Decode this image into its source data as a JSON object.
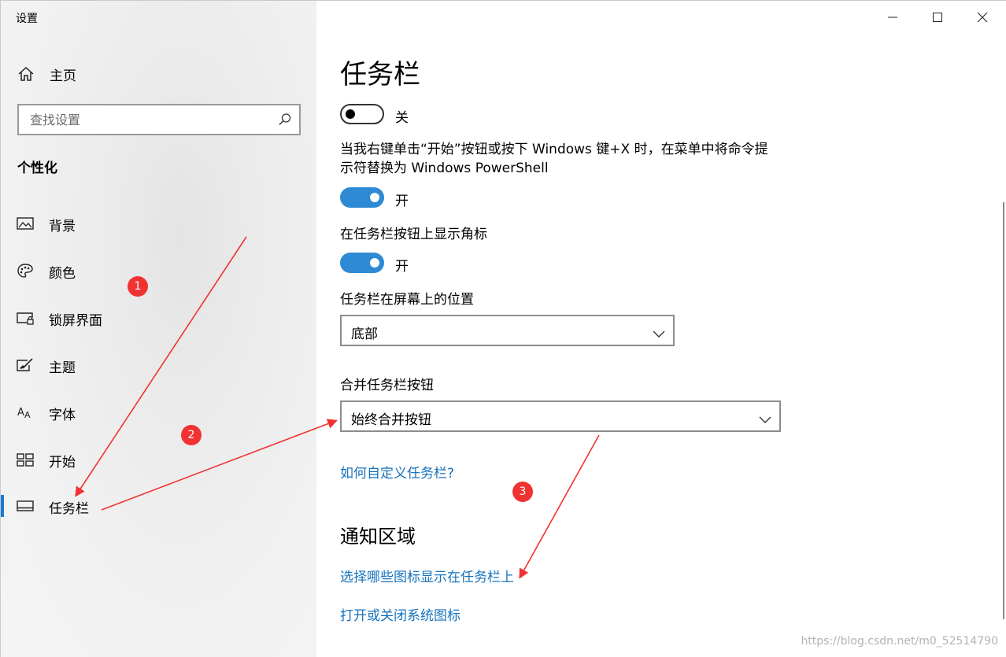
{
  "window": {
    "title": "设置",
    "caption": {
      "minimize_icon": "minimize-icon",
      "maximize_icon": "maximize-icon",
      "close_icon": "close-icon"
    }
  },
  "sidebar": {
    "home": {
      "label": "主页",
      "icon": "home-icon"
    },
    "search": {
      "placeholder": "查找设置",
      "icon": "search-icon"
    },
    "section_title": "个性化",
    "items": [
      {
        "label": "背景",
        "icon": "picture-icon",
        "selected": false
      },
      {
        "label": "颜色",
        "icon": "palette-icon",
        "selected": false
      },
      {
        "label": "锁屏界面",
        "icon": "lockscreen-icon",
        "selected": false
      },
      {
        "label": "主题",
        "icon": "theme-brush-icon",
        "selected": false
      },
      {
        "label": "字体",
        "icon": "font-icon",
        "selected": false
      },
      {
        "label": "开始",
        "icon": "start-tiles-icon",
        "selected": false
      },
      {
        "label": "任务栏",
        "icon": "taskbar-icon",
        "selected": true
      }
    ],
    "accent_color": "#1a7ad4"
  },
  "main": {
    "title": "任务栏",
    "toggle_top": {
      "state": "关",
      "on": false
    },
    "powershell_setting": {
      "text": "当我右键单击“开始”按钮或按下 Windows 键+X 时，在菜单中将命令提示符替换为 Windows PowerShell",
      "state": "开",
      "on": true
    },
    "badges_setting": {
      "text": "在任务栏按钮上显示角标",
      "state": "开",
      "on": true
    },
    "position_setting": {
      "label": "任务栏在屏幕上的位置",
      "value": "底部"
    },
    "combine_setting": {
      "label": "合并任务栏按钮",
      "value": "始终合并按钮"
    },
    "help_link": "如何自定义任务栏?",
    "notification_area": {
      "title": "通知区域",
      "links": [
        "选择哪些图标显示在任务栏上",
        "打开或关闭系统图标"
      ]
    },
    "toggle_color": "#2e8ad4",
    "link_color": "#1773bd"
  },
  "annotations": {
    "markers": [
      "1",
      "2",
      "3"
    ],
    "color": "#f03232"
  },
  "watermark": "https://blog.csdn.net/m0_52514790"
}
